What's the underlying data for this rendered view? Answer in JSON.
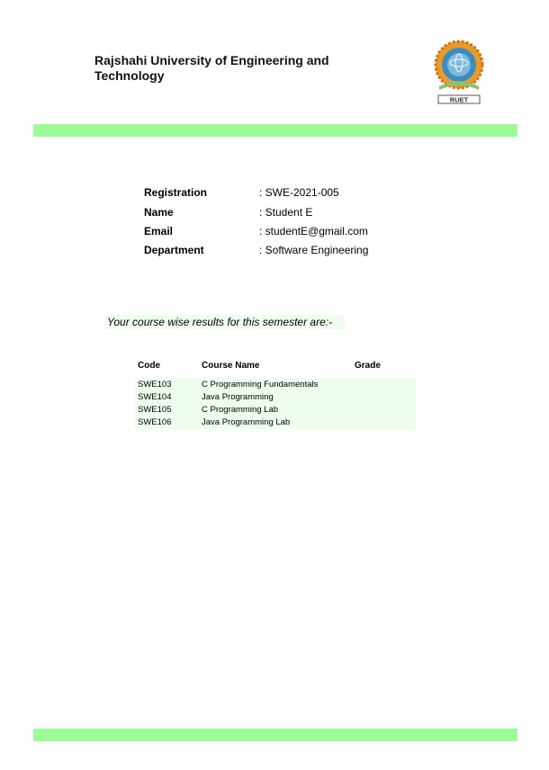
{
  "header": {
    "university_name": "Rajshahi University of Engineering and Technology",
    "logo_text": "RUET"
  },
  "colors": {
    "band": "#9cfb98",
    "highlight": "#effdef",
    "logo_gold": "#e89a2c",
    "logo_blue": "#3d8bbf",
    "logo_green": "#8fc26a"
  },
  "student": {
    "registration_label": "Registration",
    "registration_value": ": SWE-2021-005",
    "name_label": "Name",
    "name_value": ": Student E",
    "email_label": "Email",
    "email_value": ": studentE@gmail.com",
    "department_label": "Department",
    "department_value": ": Software Engineering"
  },
  "results": {
    "message": "Your course wise results for this semester are:-",
    "headers": {
      "code": "Code",
      "name": "Course Name",
      "grade": "Grade"
    },
    "rows": [
      {
        "code": "SWE103",
        "name": "C Programming Fundamentals",
        "grade": ""
      },
      {
        "code": "SWE104",
        "name": "Java Programming",
        "grade": ""
      },
      {
        "code": "SWE105",
        "name": "C Programming Lab",
        "grade": ""
      },
      {
        "code": "SWE106",
        "name": "Java Programming Lab",
        "grade": ""
      }
    ]
  }
}
